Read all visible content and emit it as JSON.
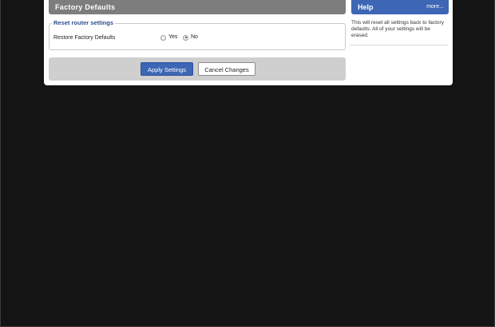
{
  "section": {
    "title": "Factory Defaults"
  },
  "fieldset": {
    "legend": "Reset router settings",
    "row_label": "Restore Factory Defaults",
    "options": [
      {
        "label": "Yes",
        "checked": false
      },
      {
        "label": "No",
        "checked": true
      }
    ]
  },
  "actions": {
    "apply_label": "Apply Settings",
    "cancel_label": "Cancel Changes"
  },
  "help": {
    "title": "Help",
    "more_link": "more...",
    "text": "This will reset all settings back to factory defaults. All of your settings will be erased."
  },
  "colors": {
    "accent": "#3d66b5",
    "section_header": "#7d7d7d",
    "legend_text": "#2d4f8f",
    "background": "#141414",
    "actions_bar": "#cfcfcf"
  }
}
